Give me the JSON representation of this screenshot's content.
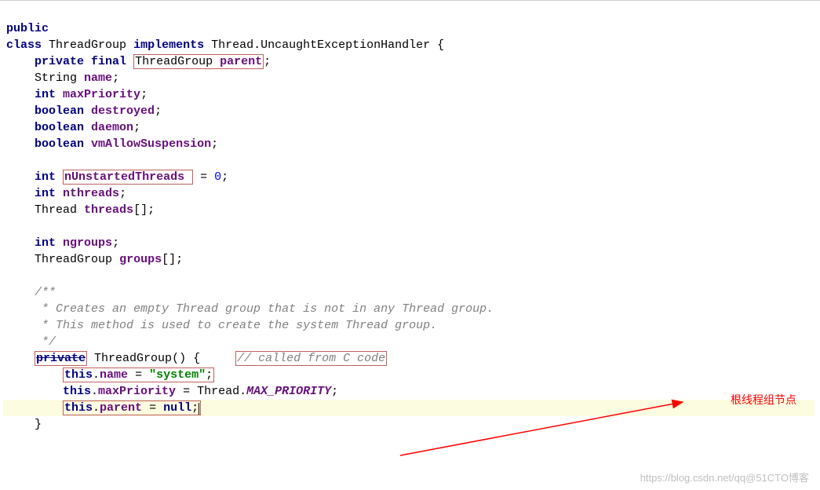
{
  "code": {
    "public": "public",
    "class_kw": "class",
    "class_name": "ThreadGroup",
    "implements_kw": "implements",
    "iface": "Thread.UncaughtExceptionHandler",
    "brace": "{",
    "private_kw": "private",
    "final_kw": "final",
    "parent_type": "ThreadGroup",
    "parent_name": "parent",
    "string_type": "String",
    "name_field": "name",
    "int_kw": "int",
    "maxPriority": "maxPriority",
    "boolean_kw": "boolean",
    "destroyed": "destroyed",
    "daemon": "daemon",
    "vmAllow": "vmAllowSuspension",
    "nUnstarted": "nUnstartedThreads",
    "zero": "0",
    "nthreads": "nthreads",
    "thread_type": "Thread",
    "threads_arr": "threads",
    "ngroups": "ngroups",
    "groups_arr": "groups",
    "jdoc_open": "/**",
    "jdoc_l1": " * Creates an empty Thread group that is not in any Thread group.",
    "jdoc_l2": " * This method is used to create the system Thread group.",
    "jdoc_close": " */",
    "private2": "private",
    "ctor": "ThreadGroup",
    "ctor_cmt": "// called from C code",
    "this_kw": "this",
    "name_ref": "name",
    "system_str": "\"system\"",
    "maxPriority_ref": "maxPriority",
    "thread_cls": "Thread",
    "max_prio": "MAX_PRIORITY",
    "parent_ref": "parent",
    "null_kw": "null",
    "close_brace": "}"
  },
  "annotation": "根线程组节点",
  "watermark_left": "https://blog.csdn.net/qq",
  "watermark_right": "@51CTO博客"
}
